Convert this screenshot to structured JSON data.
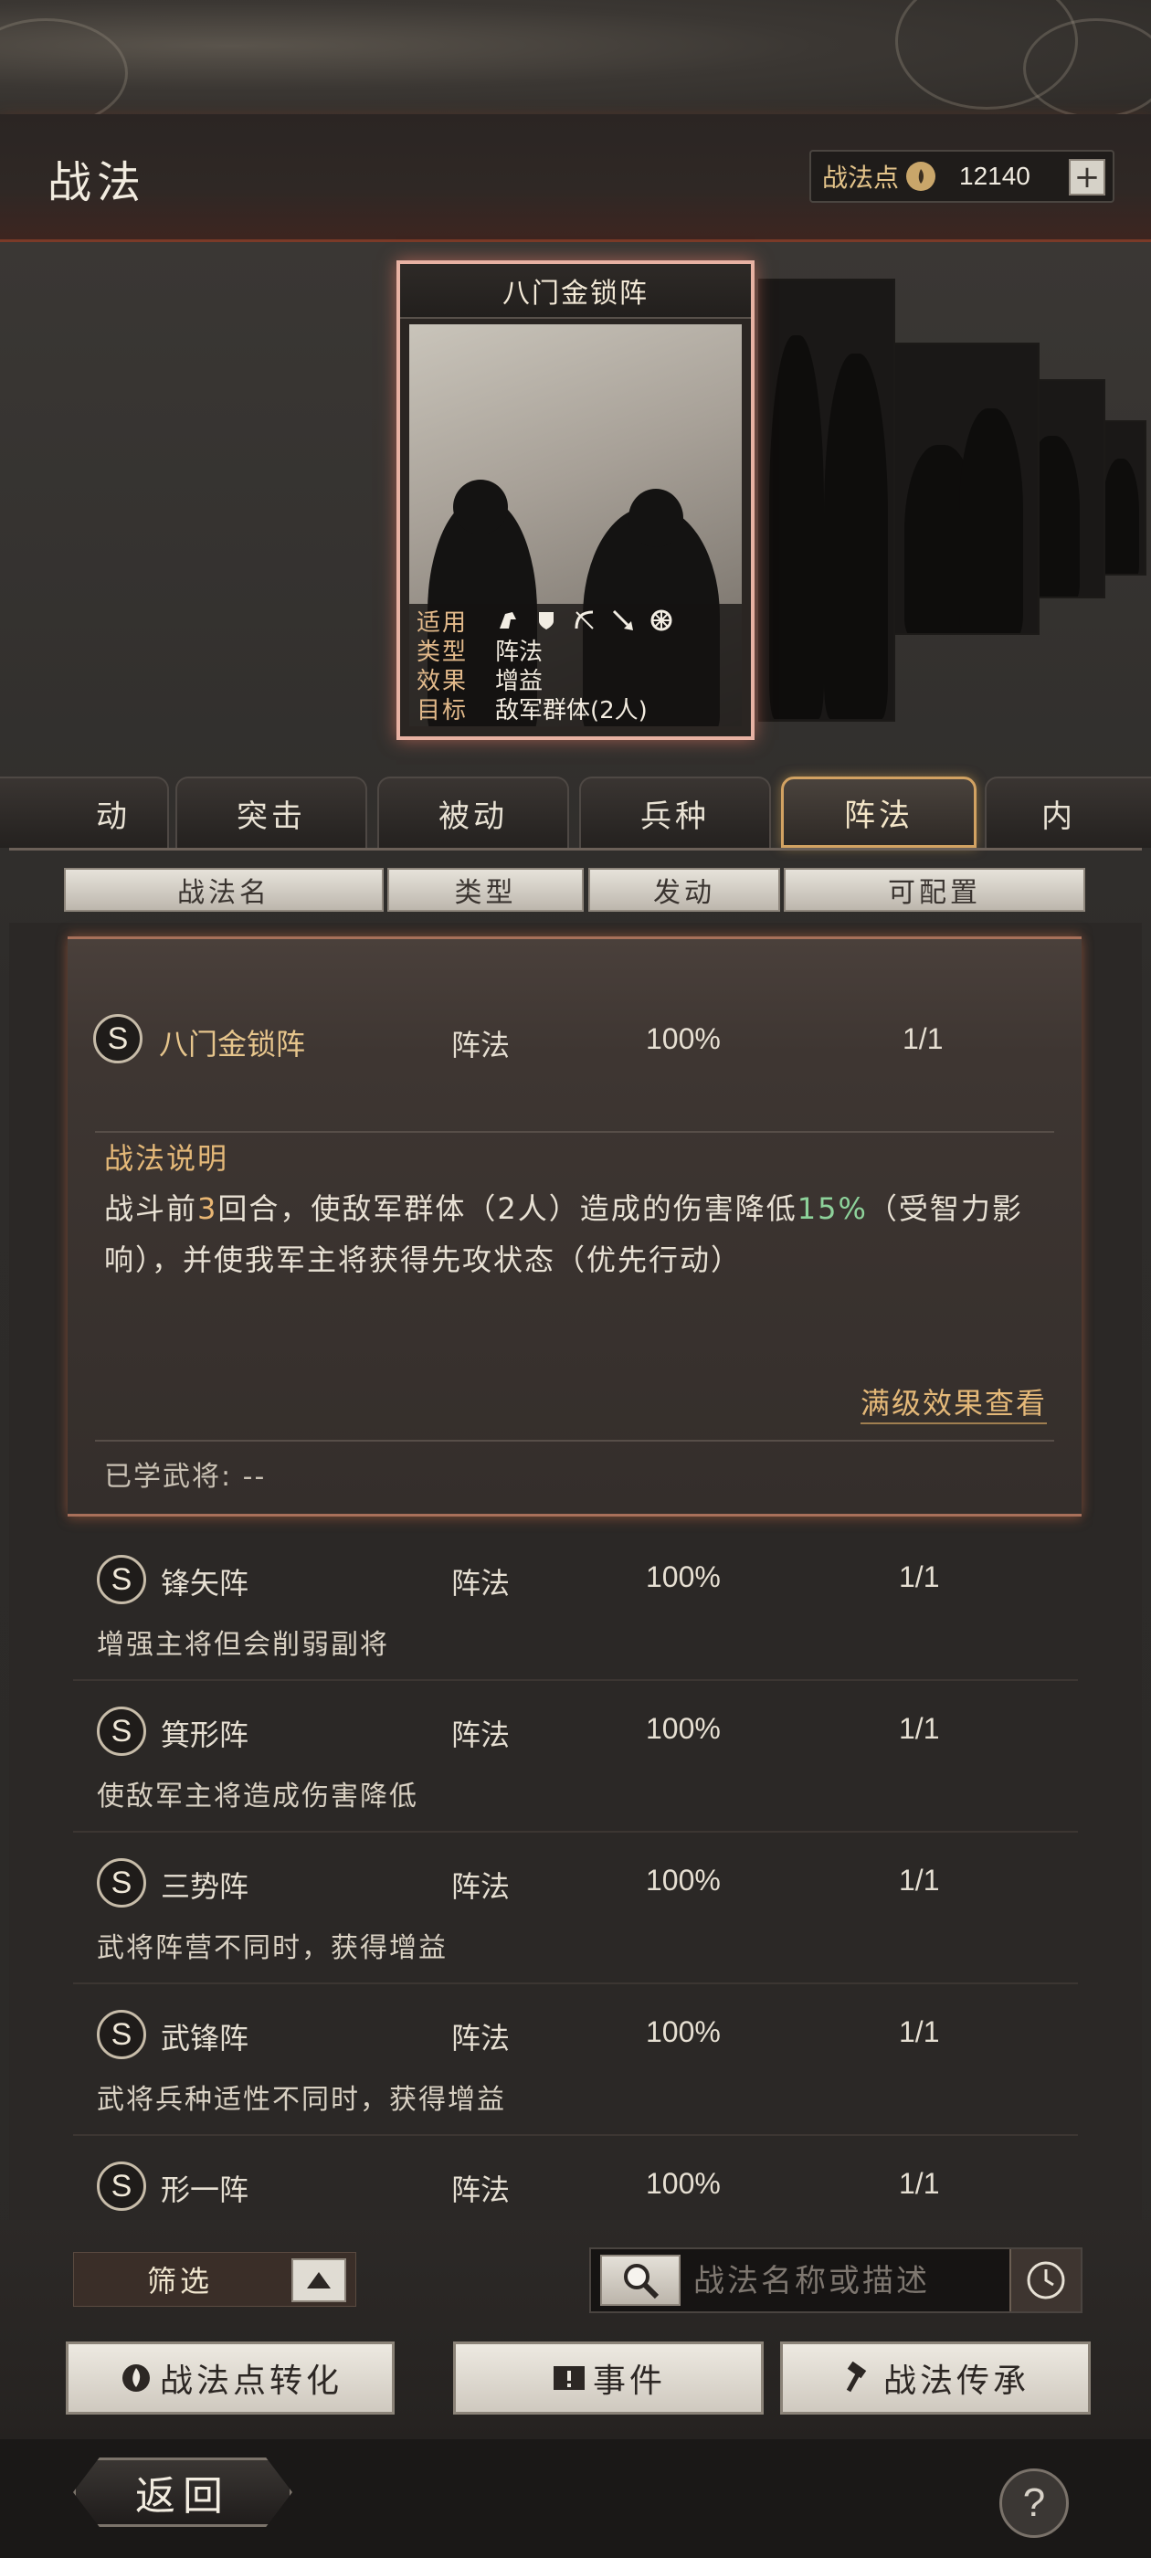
{
  "header": {
    "title": "战法",
    "points_label": "战法点",
    "points_value": "12140",
    "plus": "+"
  },
  "card": {
    "name": "八门金锁阵",
    "fields": [
      {
        "key": "适用",
        "icons": [
          "cavalry-icon",
          "shield-icon",
          "bow-icon",
          "spear-icon",
          "chariot-wheel-icon"
        ]
      },
      {
        "key": "类型",
        "value": "阵法"
      },
      {
        "key": "效果",
        "value": "增益"
      },
      {
        "key": "目标",
        "value": "敌军群体(2人)"
      }
    ]
  },
  "tabs": [
    {
      "label": "动",
      "active": false
    },
    {
      "label": "突击",
      "active": false
    },
    {
      "label": "被动",
      "active": false
    },
    {
      "label": "兵种",
      "active": false
    },
    {
      "label": "阵法",
      "active": true
    },
    {
      "label": "内",
      "active": false
    }
  ],
  "columns": [
    "战法名",
    "类型",
    "发动",
    "可配置"
  ],
  "expanded_item": {
    "grade": "S",
    "name": "八门金锁阵",
    "type": "阵法",
    "rate": "100%",
    "config": "1/1",
    "desc_title": "战法说明",
    "desc_parts": [
      "战斗前",
      "3",
      "回合，使敌军群体（2人）造成的伤害降低",
      "15%",
      "（受智力影响），并使我军主将获得先攻状态（优先行动）"
    ],
    "full_effect_link": "满级效果查看",
    "learned_label": "已学武将: --"
  },
  "items": [
    {
      "grade": "S",
      "name": "锋矢阵",
      "type": "阵法",
      "rate": "100%",
      "config": "1/1",
      "desc": "增强主将但会削弱副将"
    },
    {
      "grade": "S",
      "name": "箕形阵",
      "type": "阵法",
      "rate": "100%",
      "config": "1/1",
      "desc": "使敌军主将造成伤害降低"
    },
    {
      "grade": "S",
      "name": "三势阵",
      "type": "阵法",
      "rate": "100%",
      "config": "1/1",
      "desc": "武将阵营不同时，获得增益"
    },
    {
      "grade": "S",
      "name": "武锋阵",
      "type": "阵法",
      "rate": "100%",
      "config": "1/1",
      "desc": "武将兵种适性不同时，获得增益"
    },
    {
      "grade": "S",
      "name": "形一阵",
      "type": "阵法",
      "rate": "100%",
      "config": "1/1",
      "desc": ""
    }
  ],
  "filter": {
    "label": "筛选"
  },
  "search": {
    "placeholder": "战法名称或描述"
  },
  "buttons": {
    "convert": "战法点转化",
    "event": "事件",
    "inherit": "战法传承"
  },
  "footer": {
    "back": "返回",
    "help": "?"
  },
  "colors": {
    "accent_gold": "#e4b878",
    "highlight_green": "#8dd29a",
    "card_border": "#e8b2a3",
    "active_tab_border": "#d2a262"
  }
}
